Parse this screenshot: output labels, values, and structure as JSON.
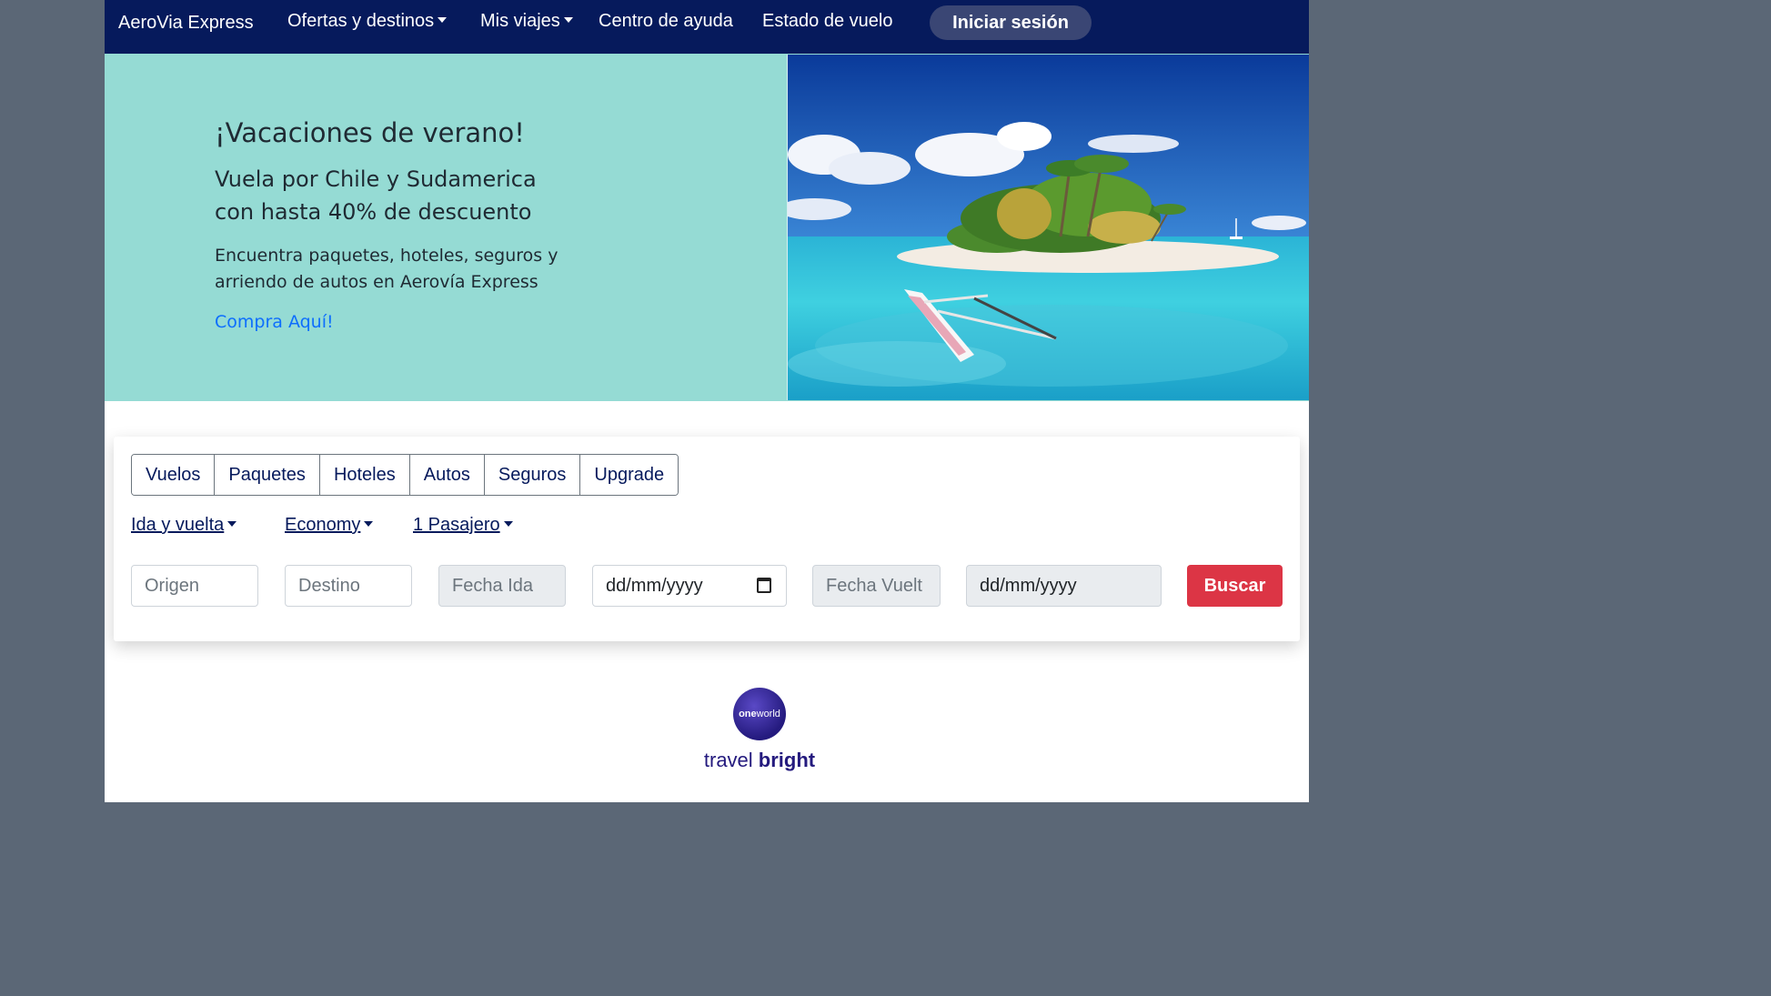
{
  "navbar": {
    "brand": "AeroVia Express",
    "items": [
      {
        "label": "Ofertas y destinos",
        "dropdown": true
      },
      {
        "label": "Mis viajes",
        "dropdown": true
      },
      {
        "label": "Centro de ayuda",
        "dropdown": false
      },
      {
        "label": "Estado de vuelo",
        "dropdown": false
      }
    ],
    "login_label": "Iniciar sesión"
  },
  "hero": {
    "title": "¡Vacaciones de verano!",
    "subtitle_line1": "Vuela por Chile y Sudamerica",
    "subtitle_line2": "con hasta 40% de descuento",
    "body_line1": "Encuentra paquetes, hoteles, seguros y",
    "body_line2": "arriendo de autos en Aerovía Express",
    "link": "Compra Aquí!",
    "image": "tropical-island-beach-canoe"
  },
  "search": {
    "tabs": [
      "Vuelos",
      "Paquetes",
      "Hoteles",
      "Autos",
      "Seguros",
      "Upgrade"
    ],
    "trip_type": "Ida y vuelta",
    "cabin": "Economy",
    "passengers": "1 Pasajero",
    "origin_placeholder": "Origen",
    "destination_placeholder": "Destino",
    "depart_label_placeholder": "Fecha Ida",
    "depart_date": "dd/mm/yyyy",
    "return_label_placeholder": "Fecha Vuelt",
    "return_date": "dd/mm/yyyy",
    "search_button": "Buscar"
  },
  "footer": {
    "logo_part1": "one",
    "logo_part2": "world",
    "tag_part1": "travel",
    "tag_part2": "bright"
  },
  "colors": {
    "navbar": "#061a5c",
    "hero_bg": "#95dbd4",
    "link": "#0d6efd",
    "search_button": "#dc3545",
    "oneworld": "#241a7e"
  }
}
